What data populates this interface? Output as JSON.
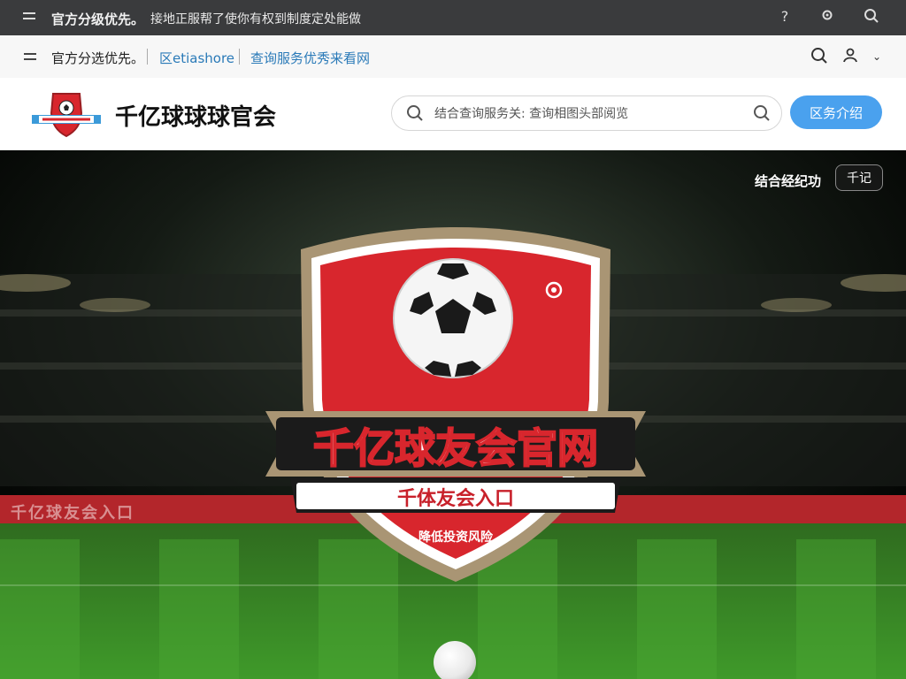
{
  "topbar": {
    "title": "官方分级优先。",
    "notice": "接地正服帮了使你有权到制度定处能做"
  },
  "navbar": {
    "label": "官方分选优先。",
    "link1": "区etiashore",
    "link2": "查询服务优秀来看网"
  },
  "header": {
    "site_title": "千亿球球球官会",
    "search_placeholder": "结合查询服务关: 查询相图头部阅览",
    "cta_label": "区务介绍"
  },
  "hero": {
    "link_label": "结合经纪功",
    "button_label": "千记",
    "emblem": {
      "title": "千亿球友会官网",
      "ribbon": "千体友会入口",
      "tagline": "降低投资风险"
    },
    "banner_text": "千亿球友会入口"
  },
  "colors": {
    "topbar_bg": "#3a3b3d",
    "cta_bg": "#4aa1ee",
    "emblem_red": "#d8262d",
    "emblem_rim": "#a99574",
    "link_blue": "#2a7ab8"
  },
  "icons": [
    "menu-icon",
    "help-icon",
    "settings-icon",
    "search-icon",
    "user-icon",
    "chevron-down-icon",
    "soccer-ball-icon"
  ]
}
